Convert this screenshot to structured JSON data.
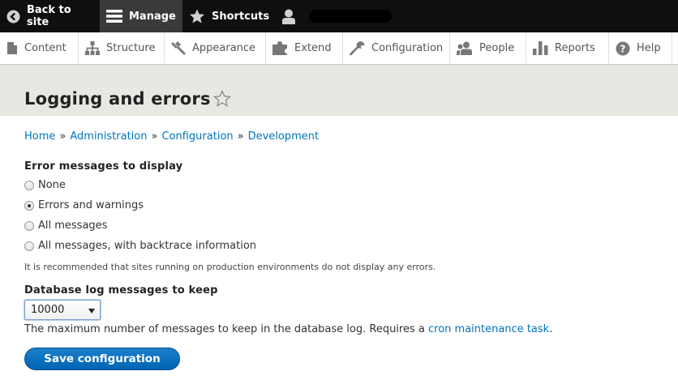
{
  "toolbar": {
    "back_label": "Back to site",
    "manage_label": "Manage",
    "shortcuts_label": "Shortcuts",
    "user_label": ""
  },
  "tray": {
    "items": [
      {
        "label": "Content",
        "icon": "content-icon"
      },
      {
        "label": "Structure",
        "icon": "structure-icon"
      },
      {
        "label": "Appearance",
        "icon": "appearance-icon"
      },
      {
        "label": "Extend",
        "icon": "extend-icon"
      },
      {
        "label": "Configuration",
        "icon": "wrench-icon"
      },
      {
        "label": "People",
        "icon": "people-icon"
      },
      {
        "label": "Reports",
        "icon": "reports-icon"
      },
      {
        "label": "Help",
        "icon": "help-icon"
      }
    ]
  },
  "page": {
    "title": "Logging and errors"
  },
  "breadcrumb": {
    "items": [
      "Home",
      "Administration",
      "Configuration",
      "Development"
    ],
    "separator": "»"
  },
  "form": {
    "error_label": "Error messages to display",
    "options": [
      {
        "label": "None",
        "checked": false
      },
      {
        "label": "Errors and warnings",
        "checked": true
      },
      {
        "label": "All messages",
        "checked": false
      },
      {
        "label": "All messages, with backtrace information",
        "checked": false
      }
    ],
    "error_description": "It is recommended that sites running on production environments do not display any errors.",
    "dblog_label": "Database log messages to keep",
    "dblog_value": "10000",
    "dblog_description_prefix": "The maximum number of messages to keep in the database log. Requires a ",
    "dblog_description_link": "cron maintenance task",
    "dblog_description_suffix": ".",
    "save_label": "Save configuration"
  },
  "colors": {
    "toolbar_bg": "#0f0f0f",
    "manage_active": "#3a3a3a",
    "link": "#0074bd",
    "primary_button": "#0071b8",
    "title_band": "#e8e8e3"
  }
}
